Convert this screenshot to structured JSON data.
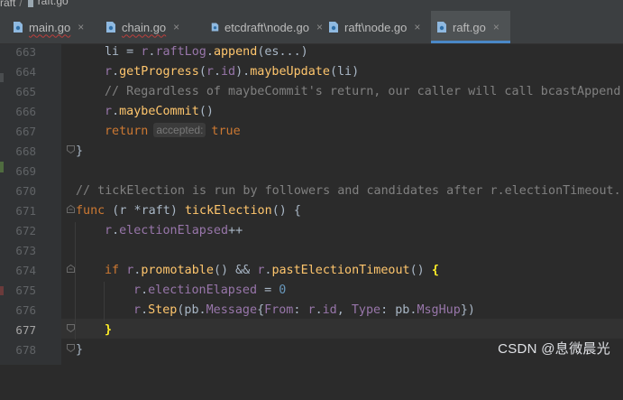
{
  "breadcrumb": {
    "folder": "raft",
    "separator": "/",
    "file": "raft.go"
  },
  "tabs": [
    {
      "label": "main.go",
      "close": "×"
    },
    {
      "label": "chain.go",
      "close": "×"
    },
    {
      "label": "etcdraft\\node.go",
      "close": "×"
    },
    {
      "label": "raft\\node.go",
      "close": "×"
    },
    {
      "label": "raft.go",
      "close": "×"
    }
  ],
  "line_numbers": [
    "663",
    "664",
    "665",
    "666",
    "667",
    "668",
    "669",
    "670",
    "671",
    "672",
    "673",
    "674",
    "675",
    "676",
    "677",
    "678"
  ],
  "code": {
    "l663": [
      "li",
      " = ",
      "r",
      ".",
      "raftLog",
      ".",
      "append",
      "(es...)"
    ],
    "l664": [
      "r",
      ".",
      "getProgress",
      "(",
      "r",
      ".",
      "id",
      ").",
      "maybeUpdate",
      "(li)"
    ],
    "l665": "// Regardless of maybeCommit's return, our caller will call bcastAppend.",
    "l666": [
      "r",
      ".",
      "maybeCommit",
      "()"
    ],
    "l667": [
      "return",
      "accepted:",
      "true"
    ],
    "l668": "}",
    "l670": "// tickElection is run by followers and candidates after r.electionTimeout.",
    "l671": [
      "func",
      " (",
      "r",
      " *",
      "raft",
      ") ",
      "tickElection",
      "() {"
    ],
    "l672": [
      "r",
      ".",
      "electionElapsed",
      "++"
    ],
    "l674": [
      "if",
      " ",
      "r",
      ".",
      "promotable",
      "() && ",
      "r",
      ".",
      "pastElectionTimeout",
      "() ",
      "{"
    ],
    "l675": [
      "r",
      ".",
      "electionElapsed",
      " = ",
      "0"
    ],
    "l676": [
      "r",
      ".",
      "Step",
      "(pb.",
      "Message",
      "{",
      "From",
      ": ",
      "r",
      ".",
      "id",
      ", ",
      "Type",
      ": pb.",
      "MsgHup",
      "})"
    ],
    "l677": "}",
    "l678": "}"
  },
  "watermark": "CSDN @息微晨光",
  "colors": {
    "background": "#2b2b2b",
    "keyword": "#cc7832",
    "field": "#9876aa",
    "function": "#ffc66d",
    "number": "#6897bb",
    "comment": "#808080",
    "active_tab_underline": "#4a88c7"
  }
}
